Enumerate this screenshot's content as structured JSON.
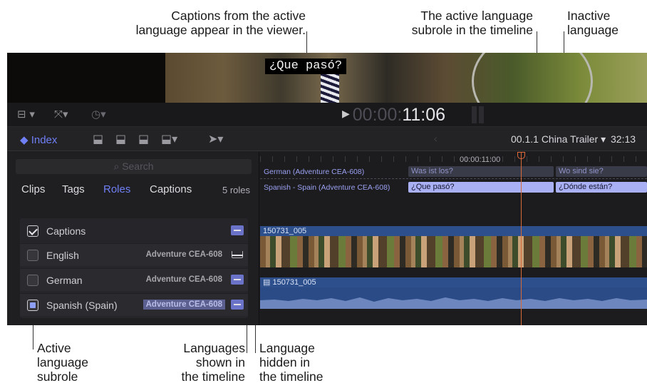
{
  "callouts": {
    "viewer_caption": [
      "Captions from the active",
      "language appear in the viewer."
    ],
    "active_subrole_timeline": [
      "The active language",
      "subrole in the timeline"
    ],
    "inactive_language": [
      "Inactive",
      "language"
    ],
    "active_language_subrole": [
      "Active",
      "language",
      "subrole"
    ],
    "languages_shown": [
      "Languages",
      "shown in",
      "the timeline"
    ],
    "language_hidden": [
      "Language",
      "hidden in",
      "the timeline"
    ]
  },
  "viewer": {
    "caption_text": "¿Que pasó?"
  },
  "topbar": {
    "timecode_dim": "00:00:",
    "timecode_bright": "11:06",
    "play_icon": "play-icon"
  },
  "toolbar": {
    "index_label": "Index",
    "project_name": "00.1.1 China Trailer",
    "duration": "32:13"
  },
  "index_panel": {
    "search_placeholder": "Search",
    "tabs": [
      {
        "label": "Clips",
        "active": false
      },
      {
        "label": "Tags",
        "active": false
      },
      {
        "label": "Roles",
        "active": true
      },
      {
        "label": "Captions",
        "active": false
      }
    ],
    "roles_count": "5 roles",
    "roles": [
      {
        "name": "Captions",
        "label": "",
        "checkbox": "checked",
        "lane": "shown"
      },
      {
        "name": "English",
        "label": "Adventure CEA-608",
        "checkbox": "unchecked",
        "lane": "hidden"
      },
      {
        "name": "German",
        "label": "Adventure CEA-608",
        "checkbox": "unchecked",
        "lane": "shown"
      },
      {
        "name": "Spanish (Spain)",
        "label": "Adventure CEA-608",
        "checkbox": "active",
        "lane": "shown"
      }
    ]
  },
  "timeline": {
    "ruler_timecode": "00:00:11:00",
    "caption_lanes": [
      {
        "label": "German (Adventure CEA-608)",
        "clips": [
          "Was ist los?",
          "Wo sind sie?"
        ],
        "state": "inactive"
      },
      {
        "label": "Spanish - Spain (Adventure CEA-608)",
        "clips": [
          "¿Que pasó?",
          "¿Dónde están?"
        ],
        "state": "active"
      }
    ],
    "video_clip": "150731_005",
    "audio_clip": "150731_005"
  },
  "colors": {
    "accent": "#6f7ff5",
    "active_caption": "#a9b0f3",
    "playhead": "#d86a3a",
    "clip_blue": "#2d4f8c"
  }
}
